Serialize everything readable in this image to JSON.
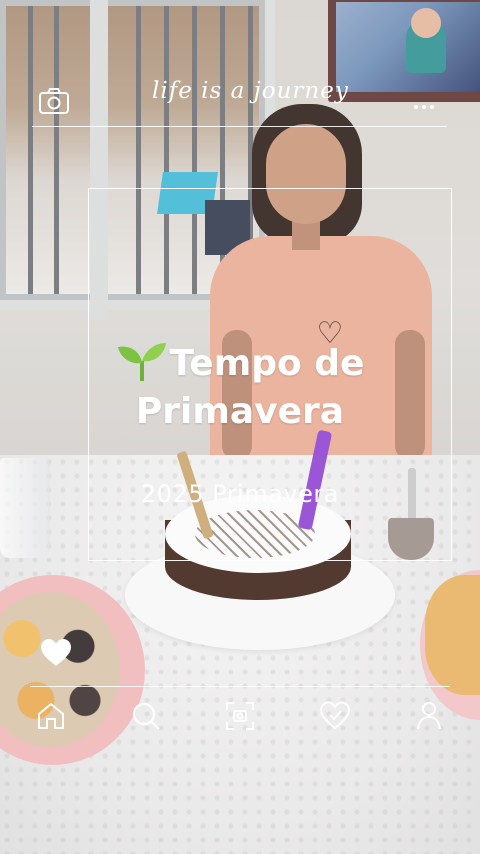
{
  "header": {
    "tagline": "life is a journey",
    "camera_icon": "camera-icon",
    "more_icon": "more-dots-icon"
  },
  "hero": {
    "emoji_icon": "sprout-icon",
    "title_line1": "Tempo de",
    "title_line2": "Primavera",
    "subtitle": "2025 Primavera"
  },
  "favorite": {
    "icon": "heart-icon"
  },
  "bottom_nav": {
    "items": [
      {
        "icon": "home-icon"
      },
      {
        "icon": "search-icon"
      },
      {
        "icon": "scan-icon"
      },
      {
        "icon": "heart-outline-icon"
      },
      {
        "icon": "profile-icon"
      }
    ]
  },
  "colors": {
    "overlay_text": "#ffffff",
    "sprout": "#7cc243"
  }
}
